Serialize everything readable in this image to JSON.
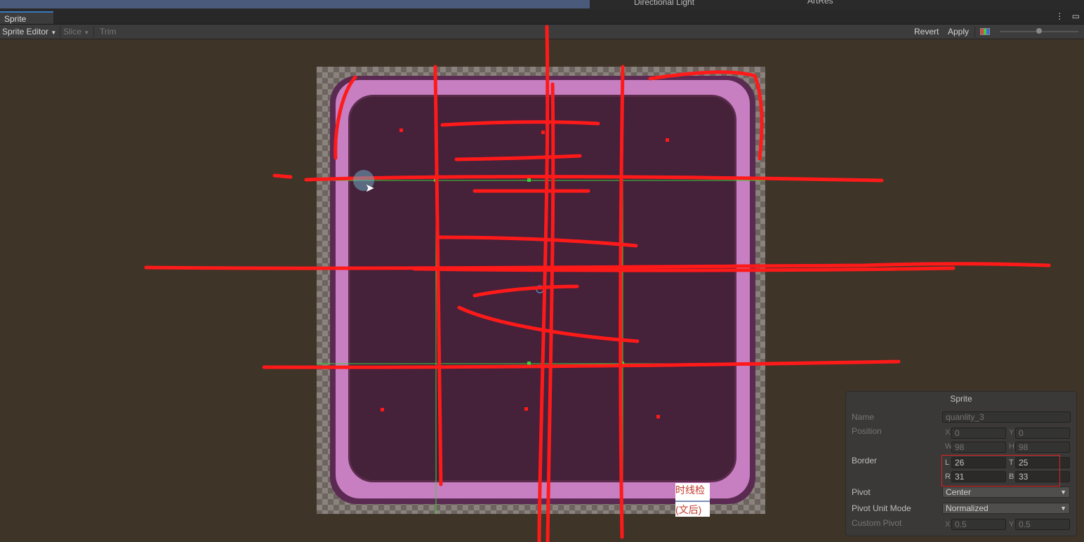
{
  "top": {
    "hierarchy_item": "Directional Light",
    "project_item": "ArtRes"
  },
  "tabbar": {
    "tab_label": "Sprite Editor",
    "more_icon": "kebab-menu-icon",
    "max_icon": "maximize-icon"
  },
  "toolbar": {
    "mode_label": "Sprite Editor",
    "slice_label": "Slice",
    "trim_label": "Trim",
    "revert_label": "Revert",
    "apply_label": "Apply",
    "color_toggle_icon": "rgb-channel-icon",
    "zoom_level": 0.5
  },
  "sprite": {
    "colors": {
      "rim": "#c77fc2",
      "inner": "#45213a",
      "outline": "#5a2a52"
    }
  },
  "inspector": {
    "title": "Sprite",
    "name_label": "Name",
    "name_value": "quanlity_3",
    "position_label": "Position",
    "x_prefix": "X",
    "x_value": "0",
    "y_prefix": "Y",
    "y_value": "0",
    "w_prefix": "W",
    "w_value": "98",
    "h_prefix": "H",
    "h_value": "98",
    "border_label": "Border",
    "l_prefix": "L",
    "l_value": "26",
    "t_prefix": "T",
    "t_value": "25",
    "r_prefix": "R",
    "r_value": "31",
    "b_prefix": "B",
    "b_value": "33",
    "pivot_label": "Pivot",
    "pivot_value": "Center",
    "pivot_unit_label": "Pivot Unit Mode",
    "pivot_unit_value": "Normalized",
    "custom_pivot_label": "Custom Pivot",
    "cx_prefix": "X",
    "cx_value": "0.5",
    "cy_prefix": "Y",
    "cy_value": "0.5"
  },
  "popup": {
    "line1": "时线检",
    "line2": "(文后)"
  },
  "annotation_color": "#ff1a1a"
}
